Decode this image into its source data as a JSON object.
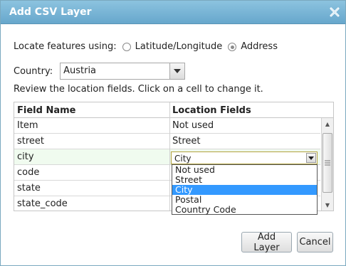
{
  "dialog": {
    "title": "Add CSV Layer"
  },
  "locate": {
    "label": "Locate features using:",
    "options": [
      {
        "label": "Latitude/Longitude",
        "checked": false
      },
      {
        "label": "Address",
        "checked": true
      }
    ]
  },
  "country": {
    "label": "Country:",
    "value": "Austria"
  },
  "instructions": "Review the location fields. Click on a cell to change it.",
  "grid": {
    "columns": [
      "Field Name",
      "Location Fields"
    ],
    "rows": [
      {
        "field": "Item",
        "location": "Not used"
      },
      {
        "field": "street",
        "location": "Street"
      },
      {
        "field": "city",
        "location": "City"
      },
      {
        "field": "code",
        "location": ""
      },
      {
        "field": "state",
        "location": ""
      },
      {
        "field": "state_code",
        "location": ""
      }
    ]
  },
  "dropdown": {
    "value": "City",
    "options": [
      "Not used",
      "Street",
      "City",
      "Postal",
      "Country Code"
    ],
    "selected": "City"
  },
  "buttons": {
    "add": "Add Layer",
    "cancel": "Cancel"
  },
  "icons": {
    "close": "close-icon",
    "dropdown_arrow": "chevron-down-icon"
  },
  "colors": {
    "titlebar": "#67a7cc",
    "selection": "#3399ff"
  }
}
